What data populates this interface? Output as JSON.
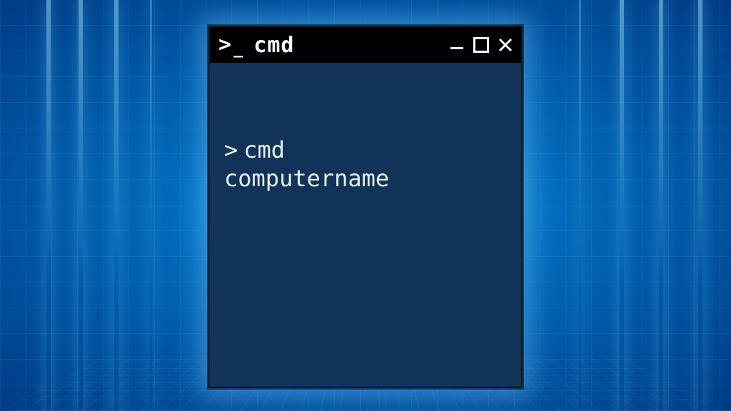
{
  "window": {
    "icon_name": "terminal-prompt-icon",
    "title": "cmd"
  },
  "terminal": {
    "prompt_char": ">",
    "command_line1": "cmd",
    "command_line2": "computername"
  },
  "colors": {
    "terminal_bg": "#103357",
    "titlebar_bg": "#000000",
    "text": "#e7eef5",
    "glow": "#6dd8ff"
  }
}
